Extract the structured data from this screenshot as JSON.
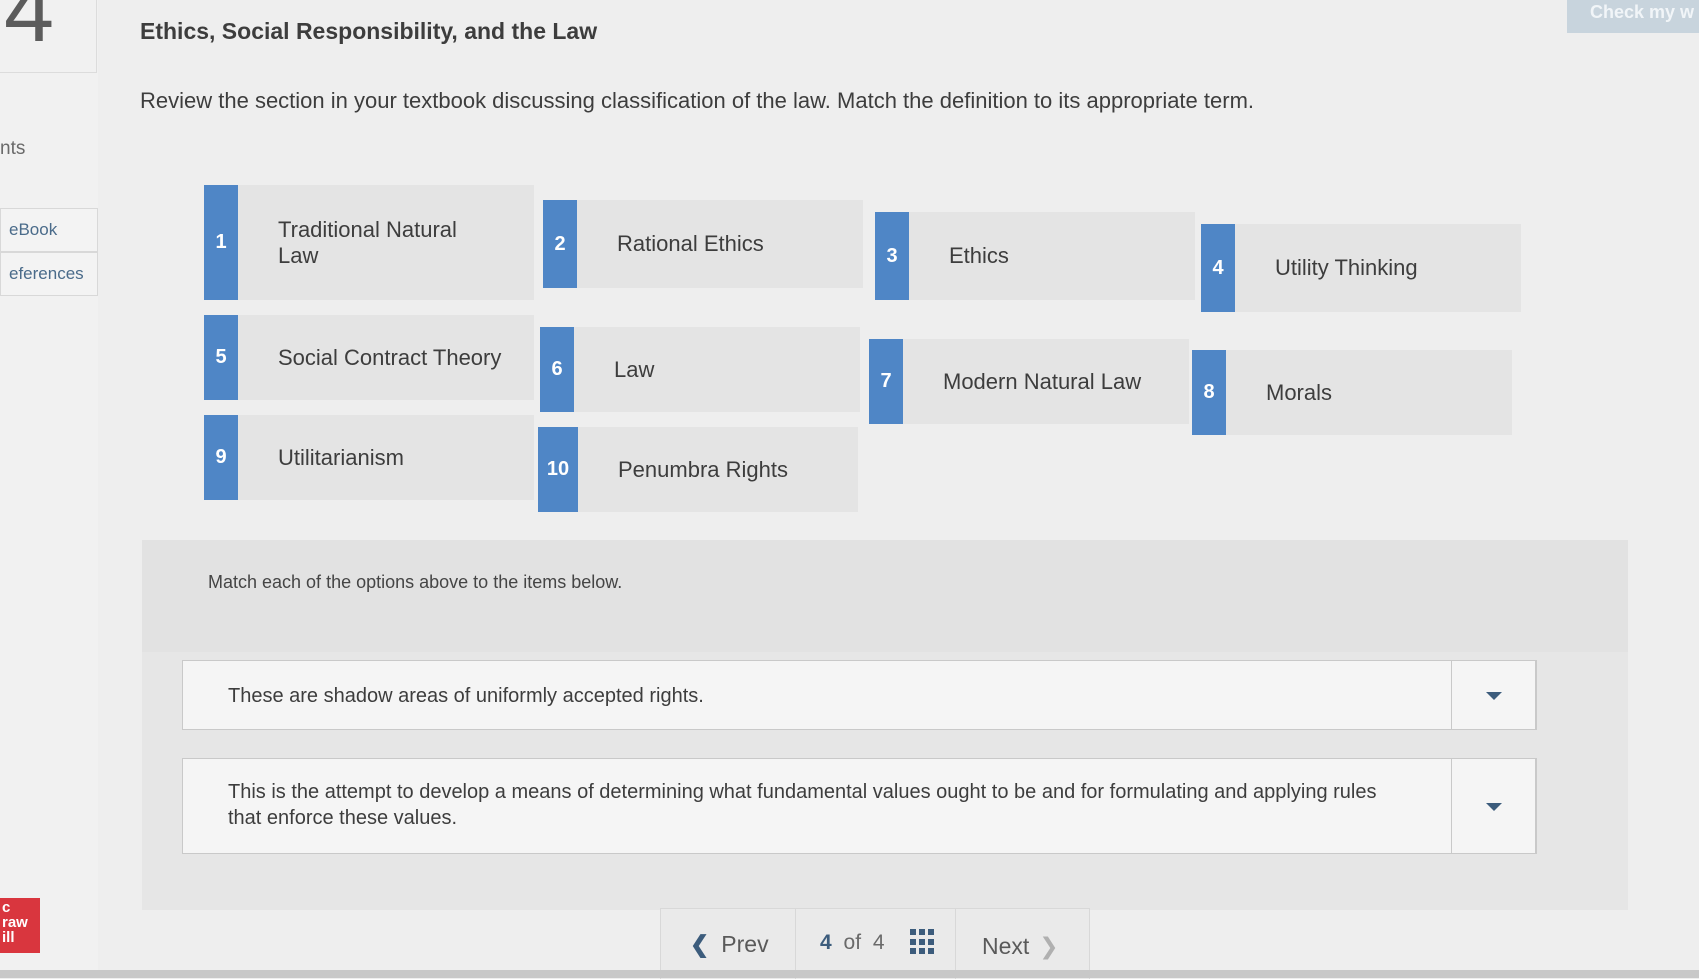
{
  "app": {
    "question_number": "4",
    "title": "Ethics, Social Responsibility, and the Law",
    "check_button": "Check my w",
    "brand_logo": "c\nraw\nill"
  },
  "sidebar": {
    "points_label": "nts",
    "ebook_label": "eBook",
    "references_label": "eferences"
  },
  "instructions": "Review the section in your textbook discussing classification of the law. Match the definition to its appropriate term.",
  "terms": [
    {
      "num": "1",
      "label": "Traditional Natural Law"
    },
    {
      "num": "2",
      "label": "Rational Ethics"
    },
    {
      "num": "3",
      "label": "Ethics"
    },
    {
      "num": "4",
      "label": "Utility Thinking"
    },
    {
      "num": "5",
      "label": "Social Contract Theory"
    },
    {
      "num": "6",
      "label": "Law"
    },
    {
      "num": "7",
      "label": "Modern Natural Law"
    },
    {
      "num": "8",
      "label": "Morals"
    },
    {
      "num": "9",
      "label": "Utilitarianism"
    },
    {
      "num": "10",
      "label": "Penumbra Rights"
    }
  ],
  "match": {
    "instruction": "Match each of the options above to the items below.",
    "items": [
      {
        "text": "These are shadow areas of uniformly accepted rights."
      },
      {
        "text": "This is the attempt to develop a means of determining what fundamental values ought to be and for formulating and applying rules that enforce these values."
      }
    ]
  },
  "footer": {
    "prev_label": "Prev",
    "current_page": "4",
    "of_label": "of",
    "total_pages": "4",
    "next_label": "Next"
  },
  "colors": {
    "accent": "#4f86c6",
    "brand_red": "#d9363e",
    "nav_blue": "#3c5c7c"
  }
}
